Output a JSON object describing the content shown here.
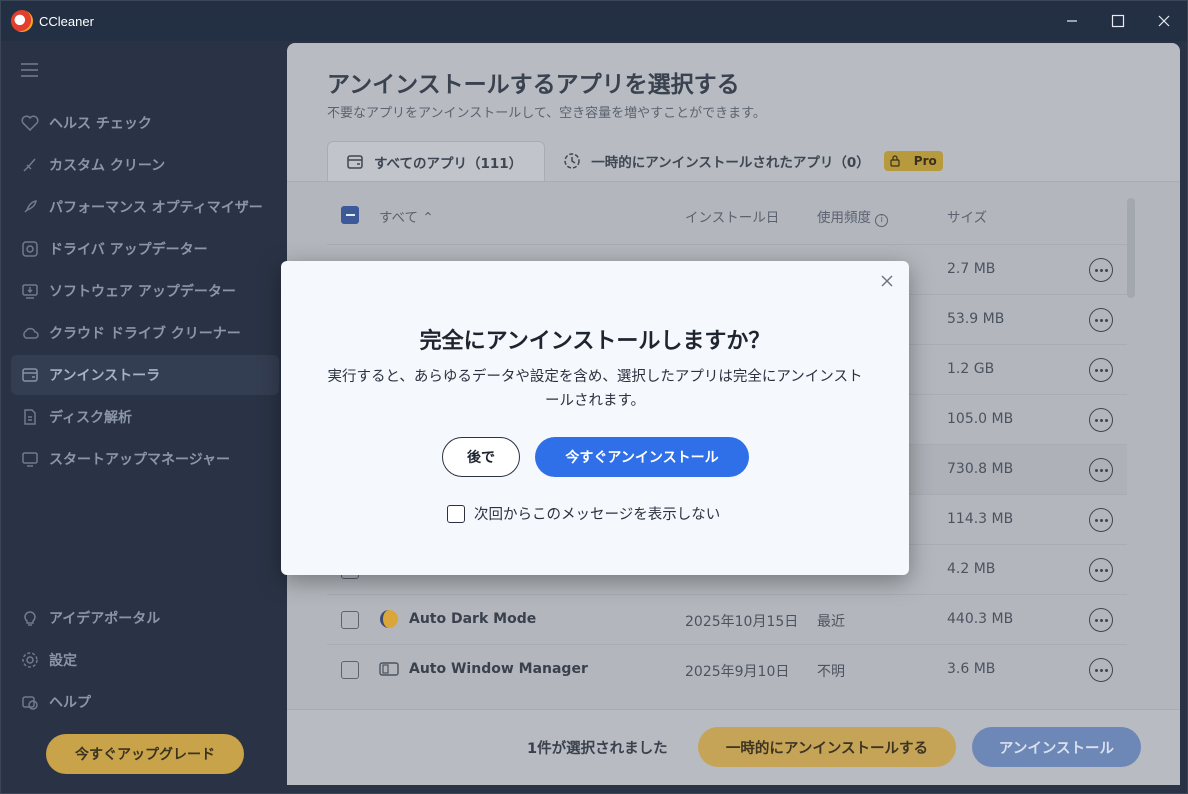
{
  "window": {
    "title": "CCleaner",
    "controls": [
      "minimize",
      "maximize",
      "close"
    ]
  },
  "sidebar": {
    "items": [
      {
        "label": "ヘルス チェック",
        "icon": "heart-icon"
      },
      {
        "label": "カスタム クリーン",
        "icon": "brush-icon"
      },
      {
        "label": "パフォーマンス オプティマイザー",
        "icon": "rocket-icon"
      },
      {
        "label": "ドライバ アップデーター",
        "icon": "driver-icon"
      },
      {
        "label": "ソフトウェア アップデーター",
        "icon": "software-update-icon"
      },
      {
        "label": "クラウド ドライブ クリーナー",
        "icon": "cloud-icon"
      },
      {
        "label": "アンインストーラ",
        "icon": "uninstaller-icon",
        "active": true
      },
      {
        "label": "ディスク解析",
        "icon": "disk-analysis-icon"
      },
      {
        "label": "スタートアップマネージャー",
        "icon": "monitor-icon"
      }
    ],
    "bottom_items": [
      {
        "label": "アイデアポータル",
        "icon": "lightbulb-icon"
      },
      {
        "label": "設定",
        "icon": "gear-icon"
      },
      {
        "label": "ヘルプ",
        "icon": "help-icon"
      }
    ],
    "upgrade_label": "今すぐアップグレード"
  },
  "main": {
    "title": "アンインストールするアプリを選択する",
    "subtitle": "不要なアプリをアンインストールして、空き容量を増やすことができます。",
    "tabs": [
      {
        "label": "すべてのアプリ（111）",
        "active": true
      },
      {
        "label": "一時的にアンインストールされたアプリ（0）",
        "badge": "Pro"
      }
    ],
    "columns": {
      "all": "すべて",
      "install_date": "インストール日",
      "frequency": "使用頻度",
      "size": "サイズ"
    },
    "rows": [
      {
        "name": "",
        "date": "",
        "freq": "",
        "size": "2.7 MB"
      },
      {
        "name": "",
        "date": "",
        "freq": "",
        "size": "53.9 MB"
      },
      {
        "name": "",
        "date": "",
        "freq": "",
        "size": "1.2 GB"
      },
      {
        "name": "",
        "date": "",
        "freq": "",
        "size": "105.0 MB"
      },
      {
        "name": "",
        "date": "",
        "freq": "",
        "size": "730.8 MB"
      },
      {
        "name": "",
        "date": "",
        "freq": "",
        "size": "114.3 MB"
      },
      {
        "name": "",
        "date": "",
        "freq": "",
        "size": "4.2 MB"
      },
      {
        "name": "Auto Dark Mode",
        "date": "2025年10月15日",
        "freq": "最近",
        "size": "440.3 MB"
      },
      {
        "name": "Auto Window Manager",
        "date": "2025年9月10日",
        "freq": "不明",
        "size": "3.6 MB"
      }
    ],
    "footer": {
      "selected_text": "1件が選択されました",
      "temp_uninstall_label": "一時的にアンインストールする",
      "uninstall_label": "アンインストール"
    }
  },
  "modal": {
    "title": "完全にアンインストールしますか？",
    "body": "実行すると、あらゆるデータや設定を含め、選択したアプリは完全にアンインストールされます。",
    "later_label": "後で",
    "uninstall_now_label": "今すぐアンインストール",
    "dont_show_label": "次回からこのメッセージを表示しない"
  }
}
